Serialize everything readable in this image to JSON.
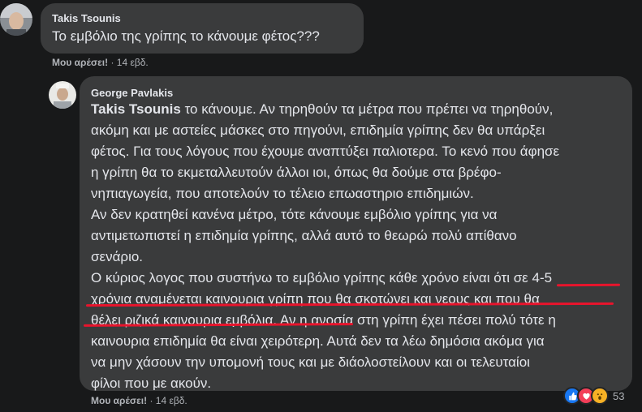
{
  "comment1": {
    "author": "Takis Tsounis",
    "text": "Το εμβόλιο της γρίπης το κάνουμε φέτος???",
    "like_label": "Μου αρέσει!",
    "separator": "·",
    "time": "14 εβδ."
  },
  "reply": {
    "author": "George Pavlakis",
    "mention": "Takis Tsounis",
    "lines": [
      " το κάνουμε. Αν τηρηθούν τα μέτρα που πρέπει να τηρηθούν,",
      "ακόμη και με αστείες μάσκες στο πηγούνι, επιδημία γρίπης δεν θα υπάρξει",
      "φέτος. Για τους λόγους που έχουμε αναπτύξει παλιοτερα. Το κενό που άφησε",
      "η γρίπη θα το εκμεταλλευτούν άλλοι ιοι, όπως θα δούμε στα βρέφο-",
      "νηπιαγωγεία, που αποτελούν το τέλειο επωαστηριο επιδημιών.",
      "Αν δεν κρατηθεί κανένα μέτρο, τότε κάνουμε εμβόλιο γρίπης για να",
      "αντιμετωπιστεί η επιδημία γρίπης, αλλά αυτό το θεωρώ πολύ απίθανο",
      "σενάριο.",
      "Ο κύριος λογος που συστήνω το εμβόλιο γρίπης κάθε χρόνο είναι ότι σε 4-5",
      "χρόνια αναμένεται καινουρια γρίπη που θα σκοτώνει και νεους και που θα",
      "θέλει ριζικά καινουρια εμβόλια. Αν η ανοσία στη γρίπη έχει πέσει πολύ τότε η",
      "καινουρια επιδημία θα είναι χειρότερη. Αυτά δεν τα λέω δημόσια ακόμα για",
      "να μην χάσουν την υπομονή τους και με διάολοστείλουν και οι τελευταίοι",
      "φίλοι που με ακούν."
    ],
    "like_label": "Μου αρέσει!",
    "separator": "·",
    "time": "14 εβδ.",
    "reactions": [
      "like-reaction",
      "love-reaction",
      "wow-reaction"
    ],
    "reaction_count": "53"
  },
  "colors": {
    "background": "#18191a",
    "bubble": "#3a3b3c",
    "text": "#e4e6eb",
    "meta": "#b0b3b8",
    "underline": "#e8142c",
    "like": "#1877f2",
    "love": "#f33e58",
    "wow": "#f7b125"
  }
}
